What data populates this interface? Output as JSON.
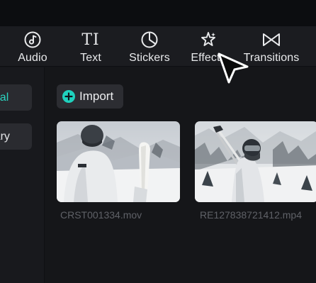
{
  "toolbar": {
    "tabs": [
      {
        "label": "Audio",
        "icon": "music-note-icon"
      },
      {
        "label": "Text",
        "icon": "text-ti-icon"
      },
      {
        "label": "Stickers",
        "icon": "sticker-icon"
      },
      {
        "label": "Effects",
        "icon": "sparkle-star-icon"
      },
      {
        "label": "Transitions",
        "icon": "bowtie-transition-icon"
      }
    ],
    "text_icon_glyph": "TI"
  },
  "sidebar": {
    "items": [
      {
        "label": "Local",
        "state": "active"
      },
      {
        "label": "Library",
        "state": "normal"
      }
    ]
  },
  "media_panel": {
    "import_label": "Import",
    "files": [
      {
        "name": "CRST001334.mov"
      },
      {
        "name": "RE127838721412.mp4"
      }
    ]
  },
  "colors": {
    "accent": "#1fd1bd",
    "panel": "#151619",
    "toolbar": "#1b1c20"
  }
}
